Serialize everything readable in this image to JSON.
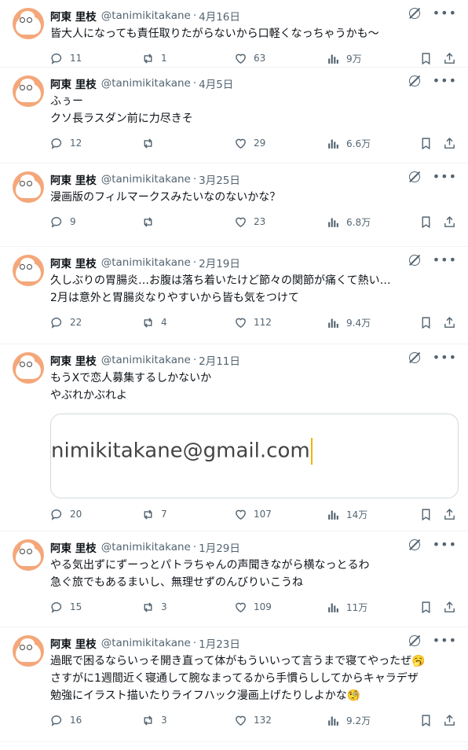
{
  "tweets": [
    {
      "name": "阿東 里枝",
      "handle": "@tanimikitakane",
      "sep": "·",
      "date": "4月16日",
      "text": "皆大人になっても責任取りたがらないから口軽くなっちゃうかも〜",
      "replies": "11",
      "retweets": "1",
      "likes": "63",
      "views": "9万"
    },
    {
      "name": "阿東 里枝",
      "handle": "@tanimikitakane",
      "sep": "·",
      "date": "4月5日",
      "text": "ふぅー\nクソ長ラスダン前に力尽きそ",
      "replies": "12",
      "retweets": "",
      "likes": "29",
      "views": "6.6万"
    },
    {
      "name": "阿東 里枝",
      "handle": "@tanimikitakane",
      "sep": "·",
      "date": "3月25日",
      "text": "漫画版のフィルマークスみたいなのないかな？",
      "replies": "9",
      "retweets": "",
      "likes": "23",
      "views": "6.8万"
    },
    {
      "name": "阿東 里枝",
      "handle": "@tanimikitakane",
      "sep": "·",
      "date": "2月19日",
      "text": "久しぶりの胃腸炎…お腹は落ち着いたけど節々の関節が痛くて熱い…\n2月は意外と胃腸炎なりやすいから皆も気をつけて",
      "replies": "22",
      "retweets": "4",
      "likes": "112",
      "views": "9.4万"
    },
    {
      "name": "阿東 里枝",
      "handle": "@tanimikitakane",
      "sep": "·",
      "date": "2月11日",
      "text": "もうXで恋人募集するしかないか\nやぶれかぶれよ",
      "media": "nimikitakane@gmail.com",
      "replies": "20",
      "retweets": "7",
      "likes": "107",
      "views": "14万"
    },
    {
      "name": "阿東 里枝",
      "handle": "@tanimikitakane",
      "sep": "·",
      "date": "1月29日",
      "text": "やる気出ずにずーっとパトラちゃんの声聞きながら横なっとるわ\n急ぐ旅でもあるまいし、無理せずのんびりいこうね",
      "replies": "15",
      "retweets": "3",
      "likes": "109",
      "views": "11万"
    },
    {
      "name": "阿東 里枝",
      "handle": "@tanimikitakane",
      "sep": "·",
      "date": "1月23日",
      "text": "過眠で困るならいっそ開き直って体がもういいって言うまで寝てやったぜ🥱\nさすがに1週間近く寝通して腕なまってるから手慣らししてからキャラデザ\n勉強にイラスト描いたりライフハック漫画上げたりしよかな🧐",
      "replies": "16",
      "retweets": "3",
      "likes": "132",
      "views": "9.2万"
    }
  ],
  "icons": {
    "reply": "reply-icon",
    "retweet": "retweet-icon",
    "like": "heart-icon",
    "views": "views-icon",
    "bookmark": "bookmark-icon",
    "share": "share-icon",
    "grok": "grok-icon",
    "more": "more-icon"
  }
}
